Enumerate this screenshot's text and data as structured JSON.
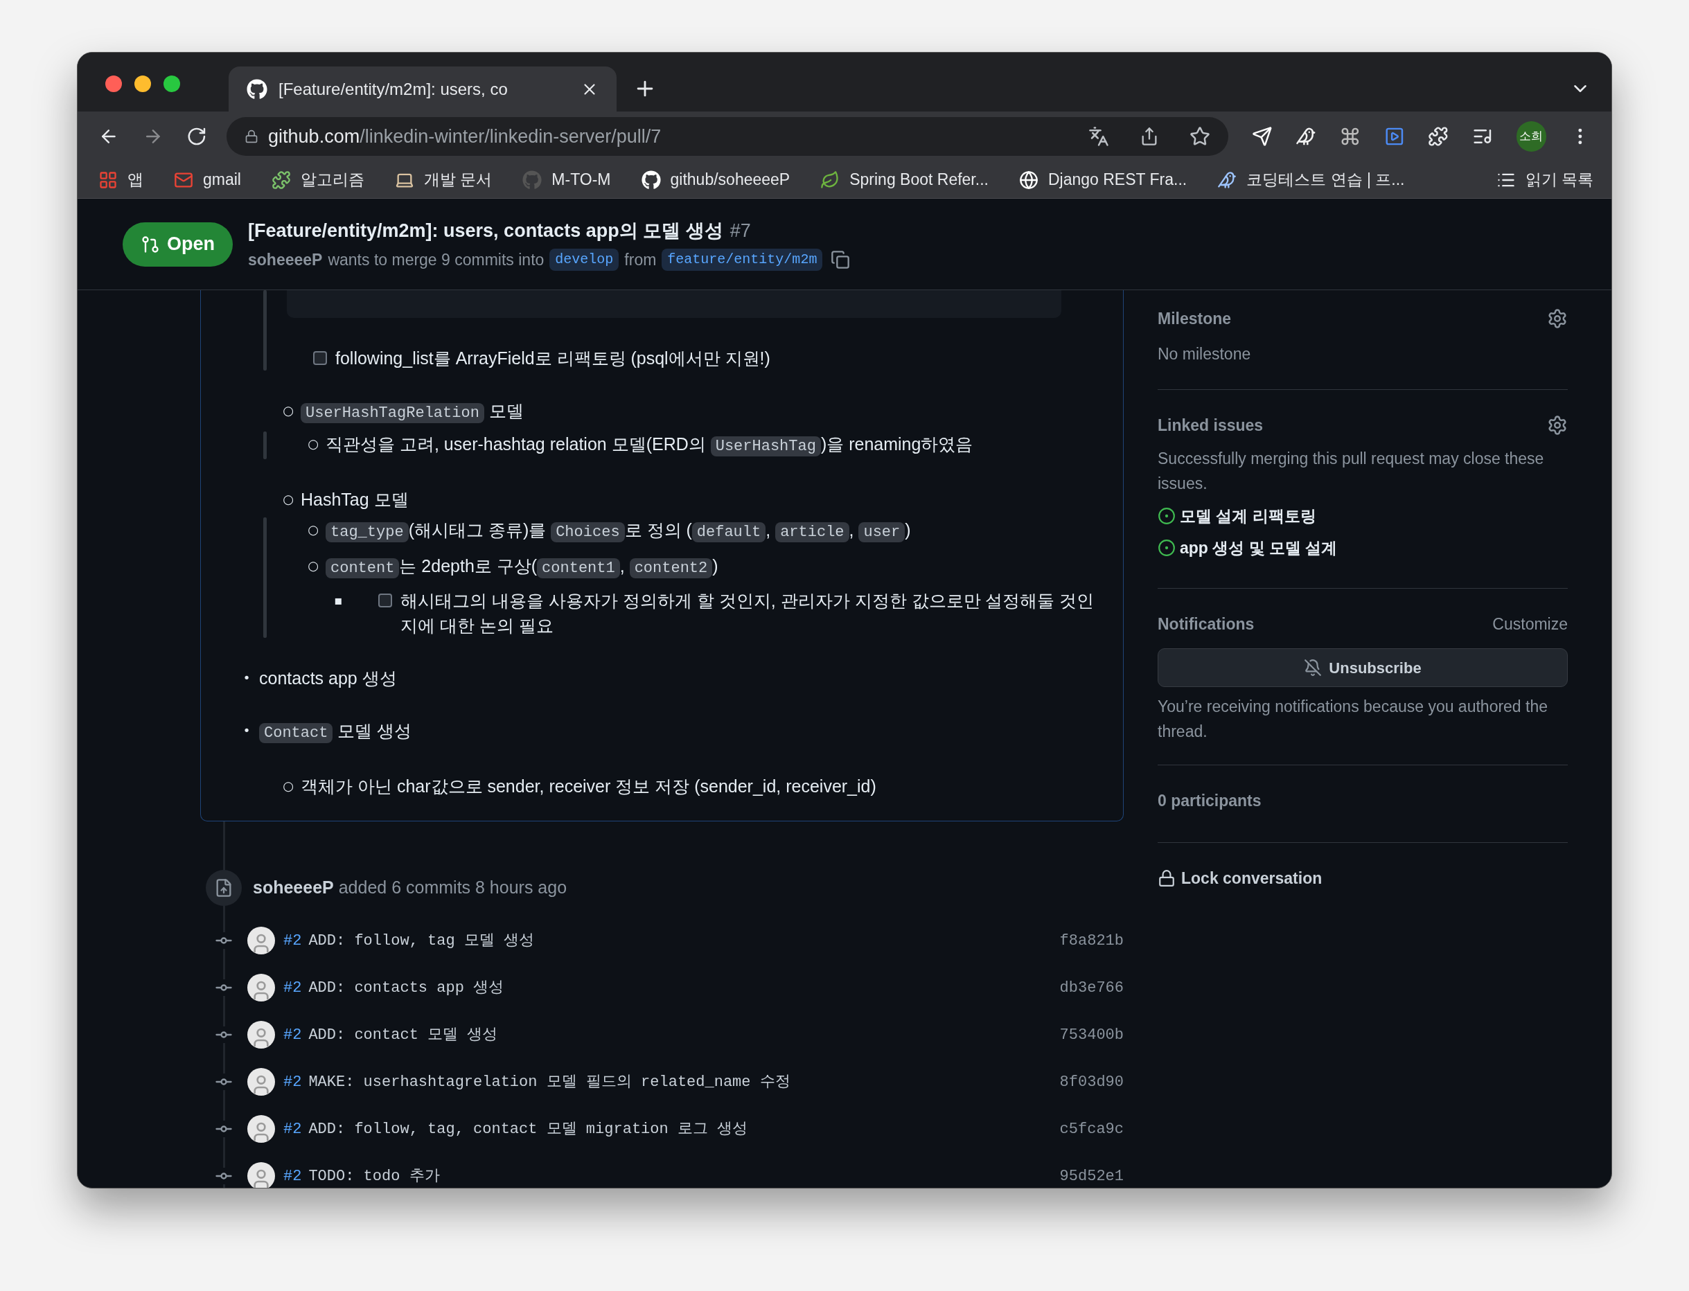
{
  "browser": {
    "tab": {
      "title": "[Feature/entity/m2m]: users, co"
    },
    "address": {
      "host": "github.com",
      "path": "/linkedin-winter/linkedin-server/pull/7"
    },
    "profile": "소희",
    "bookmarks": [
      {
        "label": "앱"
      },
      {
        "label": "gmail"
      },
      {
        "label": "알고리즘"
      },
      {
        "label": "개발 문서"
      },
      {
        "label": "M-TO-M"
      },
      {
        "label": "github/soheeeeP"
      },
      {
        "label": "Spring Boot Refer..."
      },
      {
        "label": "Django REST Fra..."
      },
      {
        "label": "코딩테스트 연습 | 프..."
      }
    ],
    "reading_list": "읽기 목록"
  },
  "pr_header": {
    "state": "Open",
    "title": "[Feature/entity/m2m]: users, contacts app의 모델 생성",
    "number": "#7",
    "author": "soheeeeP",
    "merge_text": "wants to merge 9 commits into",
    "base": "develop",
    "from": "from",
    "head": "feature/entity/m2m"
  },
  "description": {
    "items": [
      {
        "kind": "continuation",
        "children": [
          {
            "kind": "continuation",
            "bar": true,
            "children": [
              {
                "kind": "code_block"
              },
              {
                "kind": "task",
                "checked": false,
                "parts": [
                  {
                    "kind": "text",
                    "text": "following_list를 ArrayField로 리팩토링 (psql에서만 지원!)"
                  }
                ]
              }
            ]
          },
          {
            "kind": "bullet",
            "marker": "○",
            "bar": true,
            "parts": [
              {
                "kind": "code",
                "text": "UserHashTagRelation"
              },
              {
                "kind": "text",
                "text": " 모델"
              }
            ],
            "children": [
              {
                "kind": "bullet",
                "marker": "○",
                "parts": [
                  {
                    "kind": "text",
                    "text": "직관성을 고려, user-hashtag relation 모델(ERD의 "
                  },
                  {
                    "kind": "code",
                    "text": "UserHashTag"
                  },
                  {
                    "kind": "text",
                    "text": ")을 renaming하였음"
                  }
                ]
              }
            ]
          },
          {
            "kind": "bullet",
            "marker": "○",
            "bar": true,
            "parts": [
              {
                "kind": "text",
                "text": "HashTag 모델"
              }
            ],
            "children": [
              {
                "kind": "bullet",
                "marker": "○",
                "parts": [
                  {
                    "kind": "code",
                    "text": "tag_type"
                  },
                  {
                    "kind": "text",
                    "text": "(해시태그 종류)를 "
                  },
                  {
                    "kind": "code",
                    "text": "Choices"
                  },
                  {
                    "kind": "text",
                    "text": "로 정의 ("
                  },
                  {
                    "kind": "code",
                    "text": "default"
                  },
                  {
                    "kind": "text",
                    "text": ", "
                  },
                  {
                    "kind": "code",
                    "text": "article"
                  },
                  {
                    "kind": "text",
                    "text": ", "
                  },
                  {
                    "kind": "code",
                    "text": "user"
                  },
                  {
                    "kind": "text",
                    "text": ")"
                  }
                ]
              },
              {
                "kind": "bullet",
                "marker": "○",
                "parts": [
                  {
                    "kind": "code",
                    "text": "content"
                  },
                  {
                    "kind": "text",
                    "text": "는 2depth로 구상("
                  },
                  {
                    "kind": "code",
                    "text": "content1"
                  },
                  {
                    "kind": "text",
                    "text": ", "
                  },
                  {
                    "kind": "code",
                    "text": "content2"
                  },
                  {
                    "kind": "text",
                    "text": ")"
                  }
                ],
                "children": [
                  {
                    "kind": "task",
                    "marker": "▪",
                    "checked": false,
                    "parts": [
                      {
                        "kind": "text",
                        "text": "해시태그의 내용을 사용자가 정의하게 할 것인지, 관리자가 지정한 값으로만 설정해둘 것인지에 대한 논의 필요"
                      }
                    ]
                  }
                ]
              }
            ]
          }
        ]
      },
      {
        "kind": "bullet",
        "marker": "•",
        "parts": [
          {
            "kind": "text",
            "text": "contacts app 생성"
          }
        ]
      },
      {
        "kind": "bullet",
        "marker": "•",
        "parts": [
          {
            "kind": "code",
            "text": "Contact"
          },
          {
            "kind": "text",
            "text": " 모델 생성"
          }
        ],
        "children": [
          {
            "kind": "bullet",
            "marker": "○",
            "parts": [
              {
                "kind": "text",
                "text": "객체가 아닌 char값으로 sender, receiver 정보 저장 (sender_id, receiver_id)"
              }
            ]
          }
        ]
      }
    ]
  },
  "timeline": {
    "event": {
      "actor": "soheeeeP",
      "text": "added 6 commits 8 hours ago"
    },
    "commits": [
      {
        "ref": "#2",
        "message": "ADD: follow, tag 모델 생성",
        "sha": "f8a821b"
      },
      {
        "ref": "#2",
        "message": "ADD: contacts app 생성",
        "sha": "db3e766"
      },
      {
        "ref": "#2",
        "message": "ADD: contact 모델 생성",
        "sha": "753400b"
      },
      {
        "ref": "#2",
        "message": "MAKE: userhashtagrelation 모델 필드의 related_name 수정",
        "sha": "8f03d90"
      },
      {
        "ref": "#2",
        "message": "ADD: follow, tag, contact 모델 migration 로그 생성",
        "sha": "c5fca9c"
      },
      {
        "ref": "#2",
        "message": "TODO: todo 추가",
        "sha": "95d52e1"
      }
    ]
  },
  "sidebar": {
    "milestone": {
      "heading": "Milestone",
      "value": "No milestone"
    },
    "linked_issues": {
      "heading": "Linked issues",
      "note": "Successfully merging this pull request may close these issues.",
      "issues": [
        {
          "title": "모델 설계 리팩토링"
        },
        {
          "title": "app 생성 및 모델 설계"
        }
      ]
    },
    "notifications": {
      "heading": "Notifications",
      "customize": "Customize",
      "button": "Unsubscribe",
      "note": "You’re receiving notifications because you authored the thread."
    },
    "participants": "0 participants",
    "lock": "Lock conversation"
  }
}
